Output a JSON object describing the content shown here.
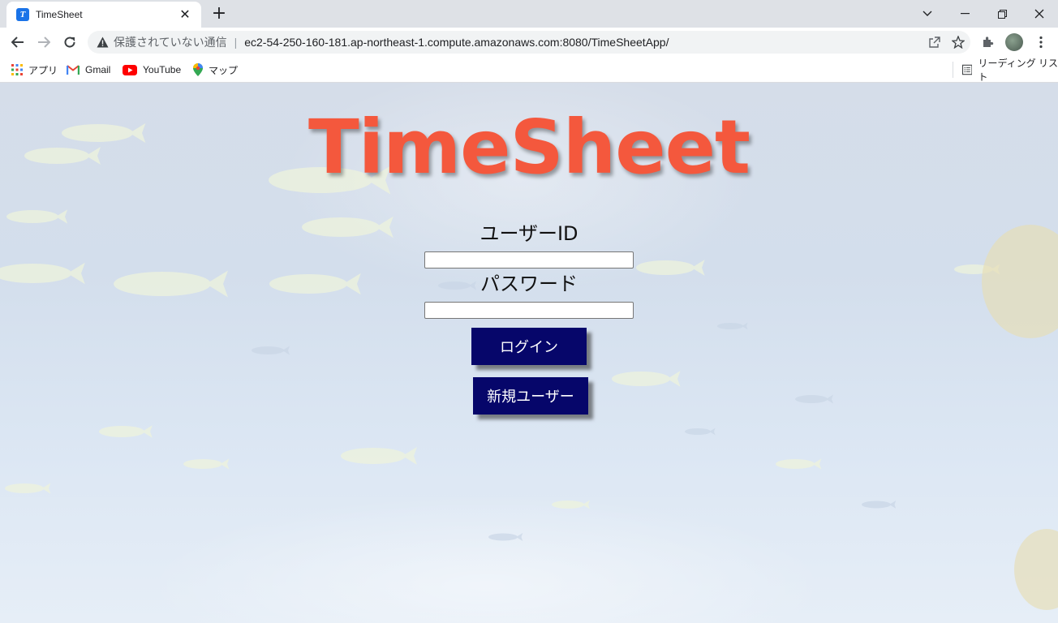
{
  "browser": {
    "tab": {
      "title": "TimeSheet",
      "favicon_letter": "Ts"
    },
    "address": {
      "security_label": "保護されていない通信",
      "url": "ec2-54-250-160-181.ap-northeast-1.compute.amazonaws.com:8080/TimeSheetApp/"
    },
    "bookmarks": [
      {
        "label": "アプリ",
        "icon": "apps-grid-icon"
      },
      {
        "label": "Gmail",
        "icon": "gmail-icon"
      },
      {
        "label": "YouTube",
        "icon": "youtube-icon"
      },
      {
        "label": "マップ",
        "icon": "maps-pin-icon"
      }
    ],
    "reading_list": "リーディング リスト"
  },
  "page": {
    "title": "TimeSheet",
    "user_id_label": "ユーザーID",
    "user_id_value": "",
    "password_label": "パスワード",
    "password_value": "",
    "login_button": "ログイン",
    "new_user_button": "新規ユーザー"
  },
  "colors": {
    "title": "#f4583d",
    "button_bg": "#06066a",
    "button_text": "#ffffff"
  }
}
